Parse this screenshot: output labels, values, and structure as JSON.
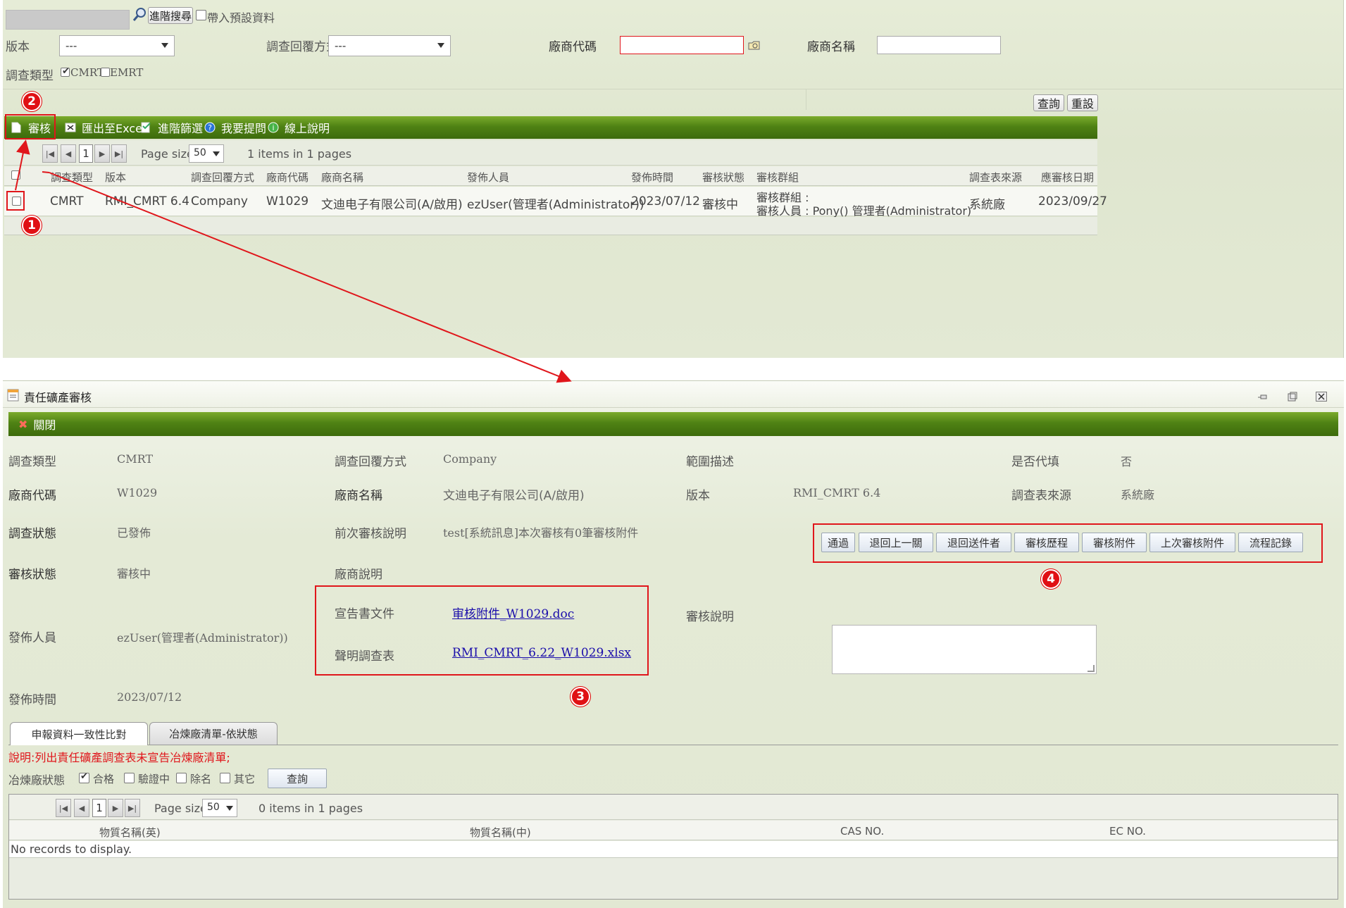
{
  "search": {
    "advanced_search_label": "進階搜尋",
    "include_defaults_label": "帶入預設資料",
    "version_label": "版本",
    "version_value": "---",
    "reply_method_label": "調查回覆方式",
    "reply_method_value": "---",
    "vendor_code_label": "廠商代碼",
    "vendor_name_label": "廠商名稱",
    "survey_type_label": "調查類型",
    "survey_types": [
      {
        "label": "CMRT",
        "checked": true
      },
      {
        "label": "EMRT",
        "checked": false
      }
    ],
    "query_button": "查詢",
    "reset_button": "重設"
  },
  "toolbar": {
    "review": "審核",
    "export_excel": "匯出至Excel",
    "advanced_filter": "進階篩選",
    "ask_question": "我要提問",
    "online_help": "線上說明"
  },
  "pager": {
    "page": "1",
    "page_size_label": "Page size:",
    "page_size": "50",
    "summary": "1 items in 1 pages"
  },
  "grid": {
    "columns": [
      "調查類型",
      "版本",
      "調查回覆方式",
      "廠商代碼",
      "廠商名稱",
      "發佈人員",
      "發佈時間",
      "審核狀態",
      "審核群組",
      "調查表來源",
      "應審核日期"
    ],
    "rows": [
      {
        "type": "CMRT",
        "version": "RMI_CMRT 6.4",
        "reply_method": "Company",
        "vendor_code": "W1029",
        "vendor_name": "文迪电子有限公司(A/啟用)",
        "publisher": "ezUser(管理者(Administrator))",
        "publish_time": "2023/07/12",
        "review_status": "審核中",
        "review_group_line1": "審核群組 :",
        "review_group_line2": "審核人員 : Pony() 管理者(Administrator)",
        "source": "系統廠",
        "due_date": "2023/09/27"
      }
    ]
  },
  "dialog": {
    "title": "責任礦產審核",
    "close_label": "關閉",
    "fields": {
      "survey_type_label": "調查類型",
      "survey_type": "CMRT",
      "reply_method_label": "調查回覆方式",
      "reply_method": "Company",
      "scope_label": "範圍描述",
      "proxy_label": "是否代填",
      "proxy": "否",
      "vendor_code_label": "廠商代碼",
      "vendor_code": "W1029",
      "vendor_name_label": "廠商名稱",
      "vendor_name": "文迪电子有限公司(A/啟用)",
      "version_label": "版本",
      "version": "RMI_CMRT 6.4",
      "source_label": "調查表來源",
      "source": "系統廠",
      "survey_status_label": "調查狀態",
      "survey_status": "已發佈",
      "prev_note_label": "前次審核說明",
      "prev_note": "test[系統訊息]本次審核有0筆審核附件",
      "review_status_label": "審核狀態",
      "review_status": "審核中",
      "vendor_note_label": "廠商說明",
      "declaration_label": "宣告書文件",
      "declaration_file": "审核附件_W1029.doc",
      "statement_label": "聲明調查表",
      "statement_file": "RMI_CMRT_6.22_W1029.xlsx",
      "review_note_label": "審核說明",
      "publisher_label": "發佈人員",
      "publisher": "ezUser(管理者(Administrator))",
      "publish_time_label": "發佈時間",
      "publish_time": "2023/07/12"
    },
    "actions": [
      "通過",
      "退回上一關",
      "退回送件者",
      "審核歷程",
      "審核附件",
      "上次審核附件",
      "流程記錄"
    ],
    "tabs": [
      "申報資料一致性比對",
      "冶煉廠清單-依狀態"
    ],
    "note": "說明:列出責任礦產調查表未宣告冶煉廠清單;",
    "smelter_status_label": "冶煉廠狀態",
    "smelter_statuses": [
      {
        "label": "合格",
        "checked": true
      },
      {
        "label": "驗證中",
        "checked": false
      },
      {
        "label": "除名",
        "checked": false
      },
      {
        "label": "其它",
        "checked": false
      }
    ],
    "query_button": "查詢",
    "pager": {
      "page": "1",
      "page_size_label": "Page size:",
      "page_size": "50",
      "summary": "0 items in 1 pages"
    },
    "sub_grid_columns": [
      "物質名稱(英)",
      "物質名稱(中)",
      "CAS NO.",
      "EC NO."
    ],
    "empty_message": "No records to display."
  },
  "annotations": [
    "1",
    "2",
    "3",
    "4"
  ],
  "colors": {
    "toolbar_green": "#4f8214",
    "annotation_red": "#e01014",
    "link_blue": "#1a0dab",
    "required_border": "#e0161b"
  }
}
